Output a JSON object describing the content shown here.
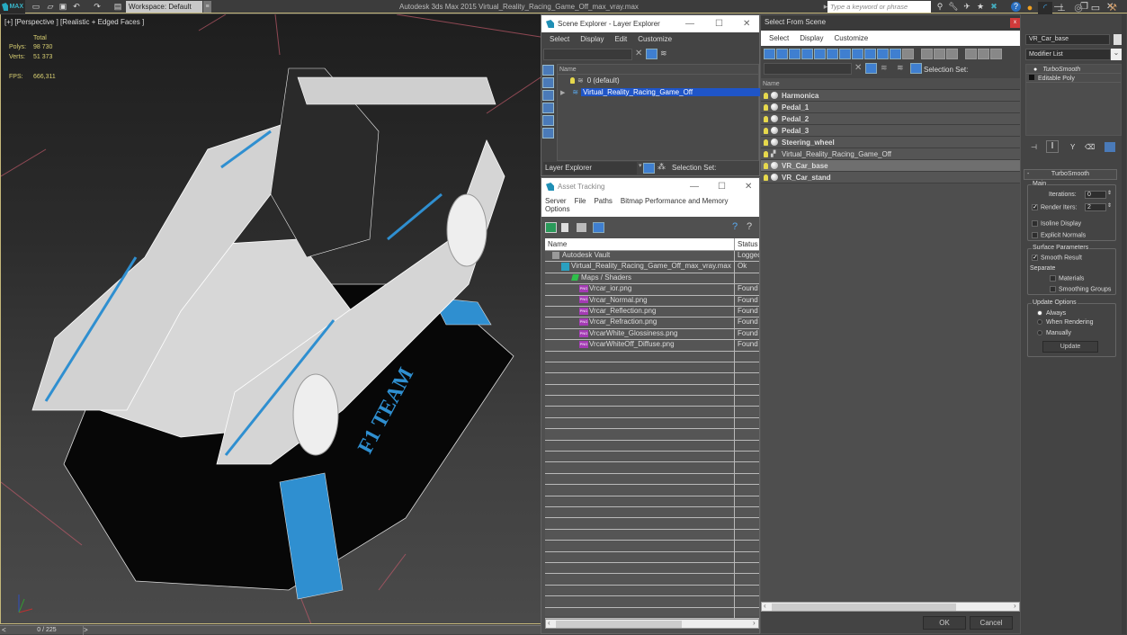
{
  "app": {
    "logo_text": "MAX",
    "title": "Autodesk 3ds Max  2015    Virtual_Reality_Racing_Game_Off_max_vray.max",
    "workspace_label": "Workspace: Default",
    "search_placeholder": "Type a keyword or phrase"
  },
  "viewport": {
    "label": "[+] [Perspective ] [Realistic + Edged Faces ]",
    "stats": {
      "header": "Total",
      "polys_label": "Polys:",
      "polys_value": "98 730",
      "verts_label": "Verts:",
      "verts_value": "51 373",
      "fps_label": "FPS:",
      "fps_value": "666,311"
    },
    "model_text": "F1 TEAM",
    "colors": {
      "accent_blue": "#2f8fd0",
      "body_white": "#d9d9d9",
      "body_black": "#050505"
    }
  },
  "timeline": {
    "prev": "<",
    "frame": "0 / 225",
    "next": ">"
  },
  "scene_explorer": {
    "title": "Scene Explorer - Layer Explorer",
    "menu": [
      "Select",
      "Display",
      "Edit",
      "Customize"
    ],
    "column_name": "Name",
    "layers": [
      {
        "name": "0 (default)",
        "selected": false,
        "expandable": false
      },
      {
        "name": "Virtual_Reality_Racing_Game_Off",
        "selected": true,
        "expandable": true
      }
    ],
    "footer_mode": "Layer Explorer",
    "selection_set_label": "Selection Set:"
  },
  "asset_tracking": {
    "title": "Asset Tracking",
    "menu": [
      "Server",
      "File",
      "Paths",
      "Bitmap Performance and Memory",
      "Options"
    ],
    "columns": [
      "Name",
      "Status"
    ],
    "rows": [
      {
        "name": "Autodesk Vault",
        "status": "Logged",
        "icon": "vault-icon",
        "indent": 1
      },
      {
        "name": "Virtual_Reality_Racing_Game_Off_max_vray.max",
        "status": "Ok",
        "icon": "max-file-icon",
        "indent": 2
      },
      {
        "name": "Maps / Shaders",
        "status": "",
        "icon": "maps-folder-icon",
        "indent": 3
      },
      {
        "name": "Vrcar_ior.png",
        "status": "Found",
        "icon": "png-icon",
        "indent": 4
      },
      {
        "name": "Vrcar_Normal.png",
        "status": "Found",
        "icon": "png-icon",
        "indent": 4
      },
      {
        "name": "Vrcar_Reflection.png",
        "status": "Found",
        "icon": "png-icon",
        "indent": 4
      },
      {
        "name": "Vrcar_Refraction.png",
        "status": "Found",
        "icon": "png-icon",
        "indent": 4
      },
      {
        "name": "VrcarWhite_Glossiness.png",
        "status": "Found",
        "icon": "png-icon",
        "indent": 4
      },
      {
        "name": "VrcarWhiteOff_Diffuse.png",
        "status": "Found",
        "icon": "png-icon",
        "indent": 4
      }
    ]
  },
  "select_from_scene": {
    "title": "Select From Scene",
    "menu": [
      "Select",
      "Display",
      "Customize"
    ],
    "selection_set_label": "Selection Set:",
    "column_name": "Name",
    "objects": [
      {
        "name": "Harmonica",
        "bold": true,
        "selected": false
      },
      {
        "name": "Pedal_1",
        "bold": true,
        "selected": false
      },
      {
        "name": "Pedal_2",
        "bold": true,
        "selected": false
      },
      {
        "name": "Pedal_3",
        "bold": true,
        "selected": false
      },
      {
        "name": "Steering_wheel",
        "bold": true,
        "selected": false
      },
      {
        "name": "Virtual_Reality_Racing_Game_Off",
        "bold": false,
        "selected": false
      },
      {
        "name": "VR_Car_base",
        "bold": true,
        "selected": true
      },
      {
        "name": "VR_Car_stand",
        "bold": true,
        "selected": false
      }
    ],
    "ok_label": "OK",
    "cancel_label": "Cancel"
  },
  "command_panel": {
    "object_name": "VR_Car_base",
    "modifier_list_label": "Modifier List",
    "stack": [
      "TurboSmooth",
      "Editable Poly"
    ],
    "rollout_title": "TurboSmooth",
    "main_group": "Main",
    "iterations_label": "Iterations:",
    "iterations_value": "0",
    "render_iters_label": "Render Iters:",
    "render_iters_value": "2",
    "render_iters_checked": true,
    "isoline_label": "Isoline Display",
    "explicit_normals_label": "Explicit Normals",
    "surface_group": "Surface Parameters",
    "smooth_result_label": "Smooth Result",
    "separate_label": "Separate",
    "materials_label": "Materials",
    "smoothing_groups_label": "Smoothing Groups",
    "update_group": "Update Options",
    "update_options": [
      "Always",
      "When Rendering",
      "Manually"
    ],
    "update_selected": "Always",
    "update_button": "Update"
  }
}
